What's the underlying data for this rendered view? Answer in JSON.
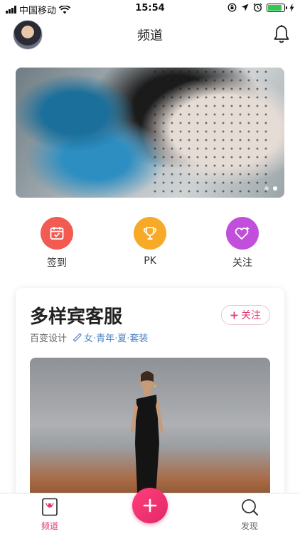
{
  "status_bar": {
    "carrier": "中国移动",
    "time": "15:54",
    "battery_level": 0.8
  },
  "header": {
    "title": "频道"
  },
  "banner": {
    "slides": 2,
    "active_slide": 2
  },
  "actions": [
    {
      "label": "签到",
      "color": "#f25a52",
      "icon": "calendar-check-icon"
    },
    {
      "label": "PK",
      "color": "#f7a928",
      "icon": "trophy-icon"
    },
    {
      "label": "关注",
      "color": "#c24fdc",
      "icon": "heart-plus-icon"
    }
  ],
  "card": {
    "title": "多样宾客服",
    "follow_label": "关注",
    "source": "百变设计",
    "tags": "女·青年·夏·套装"
  },
  "tabbar": {
    "tab_channel": "频道",
    "tab_discover": "发现"
  },
  "colors": {
    "accent": "#e03a6e",
    "tag_blue": "#4e86c6"
  }
}
